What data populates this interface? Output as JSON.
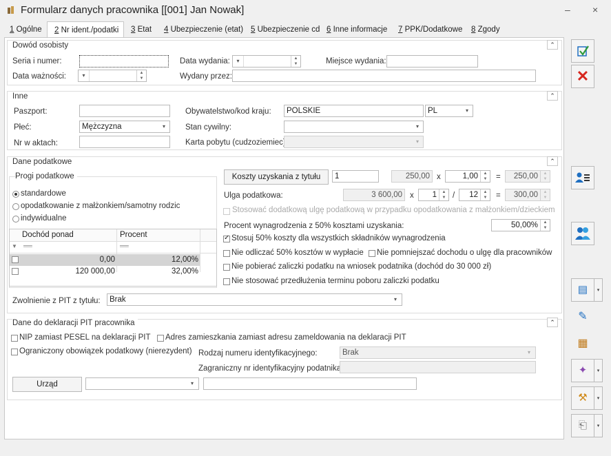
{
  "window": {
    "title": "Formularz danych pracownika [[001] Jan Nowak]",
    "minimize": "–",
    "close": "×"
  },
  "tabs": [
    {
      "key": "1",
      "label": "Ogólne"
    },
    {
      "key": "2",
      "label": "Nr ident./podatki"
    },
    {
      "key": "3",
      "label": "Etat"
    },
    {
      "key": "4",
      "label": "Ubezpieczenie (etat)"
    },
    {
      "key": "5",
      "label": "Ubezpieczenie cd"
    },
    {
      "key": "6",
      "label": "Inne informacje"
    },
    {
      "key": "7",
      "label": "PPK/Dodatkowe"
    },
    {
      "key": "8",
      "label": "Zgody"
    }
  ],
  "dowod": {
    "title": "Dowód osobisty",
    "seria_label": "Seria i numer:",
    "seria_value": "",
    "data_wydania_label": "Data wydania:",
    "data_wydania_value": "",
    "miejsce_label": "Miejsce wydania:",
    "miejsce_value": "",
    "waznosci_label": "Data ważności:",
    "waznosci_value": "",
    "wydany_label": "Wydany przez:",
    "wydany_value": ""
  },
  "inne": {
    "title": "Inne",
    "paszport_label": "Paszport:",
    "paszport_value": "",
    "obyw_label": "Obywatelstwo/kod kraju:",
    "obyw_value": "POLSKIE",
    "kraj_value": "PL",
    "plec_label": "Płeć:",
    "plec_value": "Mężczyzna",
    "stan_label": "Stan cywilny:",
    "stan_value": "",
    "akta_label": "Nr w aktach:",
    "akta_value": "",
    "karta_label": "Karta pobytu (cudzoziemiec):",
    "karta_value": ""
  },
  "podatki": {
    "title": "Dane podatkowe",
    "progi_title": "Progi podatkowe",
    "radio": [
      "standardowe",
      "opodatkowanie z małżonkiem/samotny rodzic",
      "indywidualne"
    ],
    "grid_headers": [
      "Dochód ponad",
      "Procent"
    ],
    "grid_filter": [
      "══",
      "══"
    ],
    "grid_rows": [
      {
        "dochod": "0,00",
        "procent": "12,00%"
      },
      {
        "dochod": "120 000,00",
        "procent": "32,00%"
      }
    ],
    "koszty_button": "Koszty uzyskania z tytułu",
    "koszty_count": "1",
    "koszty_base": "250,00",
    "x1": "x",
    "koszty_mult": "1,00",
    "eq1": "=",
    "koszty_total": "250,00",
    "ulga_label": "Ulga podatkowa:",
    "ulga_base": "3 600,00",
    "x2": "x",
    "ulga_num": "1",
    "slash": "/",
    "ulga_den": "12",
    "eq2": "=",
    "ulga_total": "300,00",
    "dodatkowa_ulga": "Stosować dodatkową ulgę podatkową w przypadku opodatkowania z małżonkiem/dzieckiem",
    "procent_label": "Procent wynagrodzenia z 50% kosztami uzyskania:",
    "procent_value": "50,00%",
    "cb_stosuj50": "Stosuj 50% koszty dla wszystkich składników wynagrodzenia",
    "cb_nie_odliczac": "Nie odliczać 50% kosztów w wypłacie",
    "cb_nie_pomniejszac": "Nie pomniejszać dochodu o ulgę dla pracowników",
    "cb_nie_pobierac": "Nie pobierać zaliczki podatku na wniosek podatnika (dochód do 30 000 zł)",
    "cb_nie_stosowac": "Nie stosować przedłużenia terminu poboru zaliczki podatku",
    "zwolnienie_label": "Zwolnienie z PIT z tytułu:",
    "zwolnienie_value": "Brak"
  },
  "pit": {
    "title": "Dane do deklaracji PIT pracownika",
    "cb_nip": "NIP zamiast PESEL na deklaracji PIT",
    "cb_adres": "Adres zamieszkania zamiast adresu zameldowania na deklaracji PIT",
    "cb_ograniczony": "Ograniczony obowiązek podatkowy (nierezydent)",
    "rodzaj_label": "Rodzaj numeru identyfikacyjnego:",
    "rodzaj_value": "Brak",
    "zagr_label": "Zagraniczny nr identyfikacyjny podatnika:",
    "zagr_value": "",
    "urzad_button": "Urząd",
    "urzad_value": "",
    "urzad_name": ""
  },
  "colors": {
    "accent": "#1f6fc1",
    "cancel": "#d7261e"
  }
}
